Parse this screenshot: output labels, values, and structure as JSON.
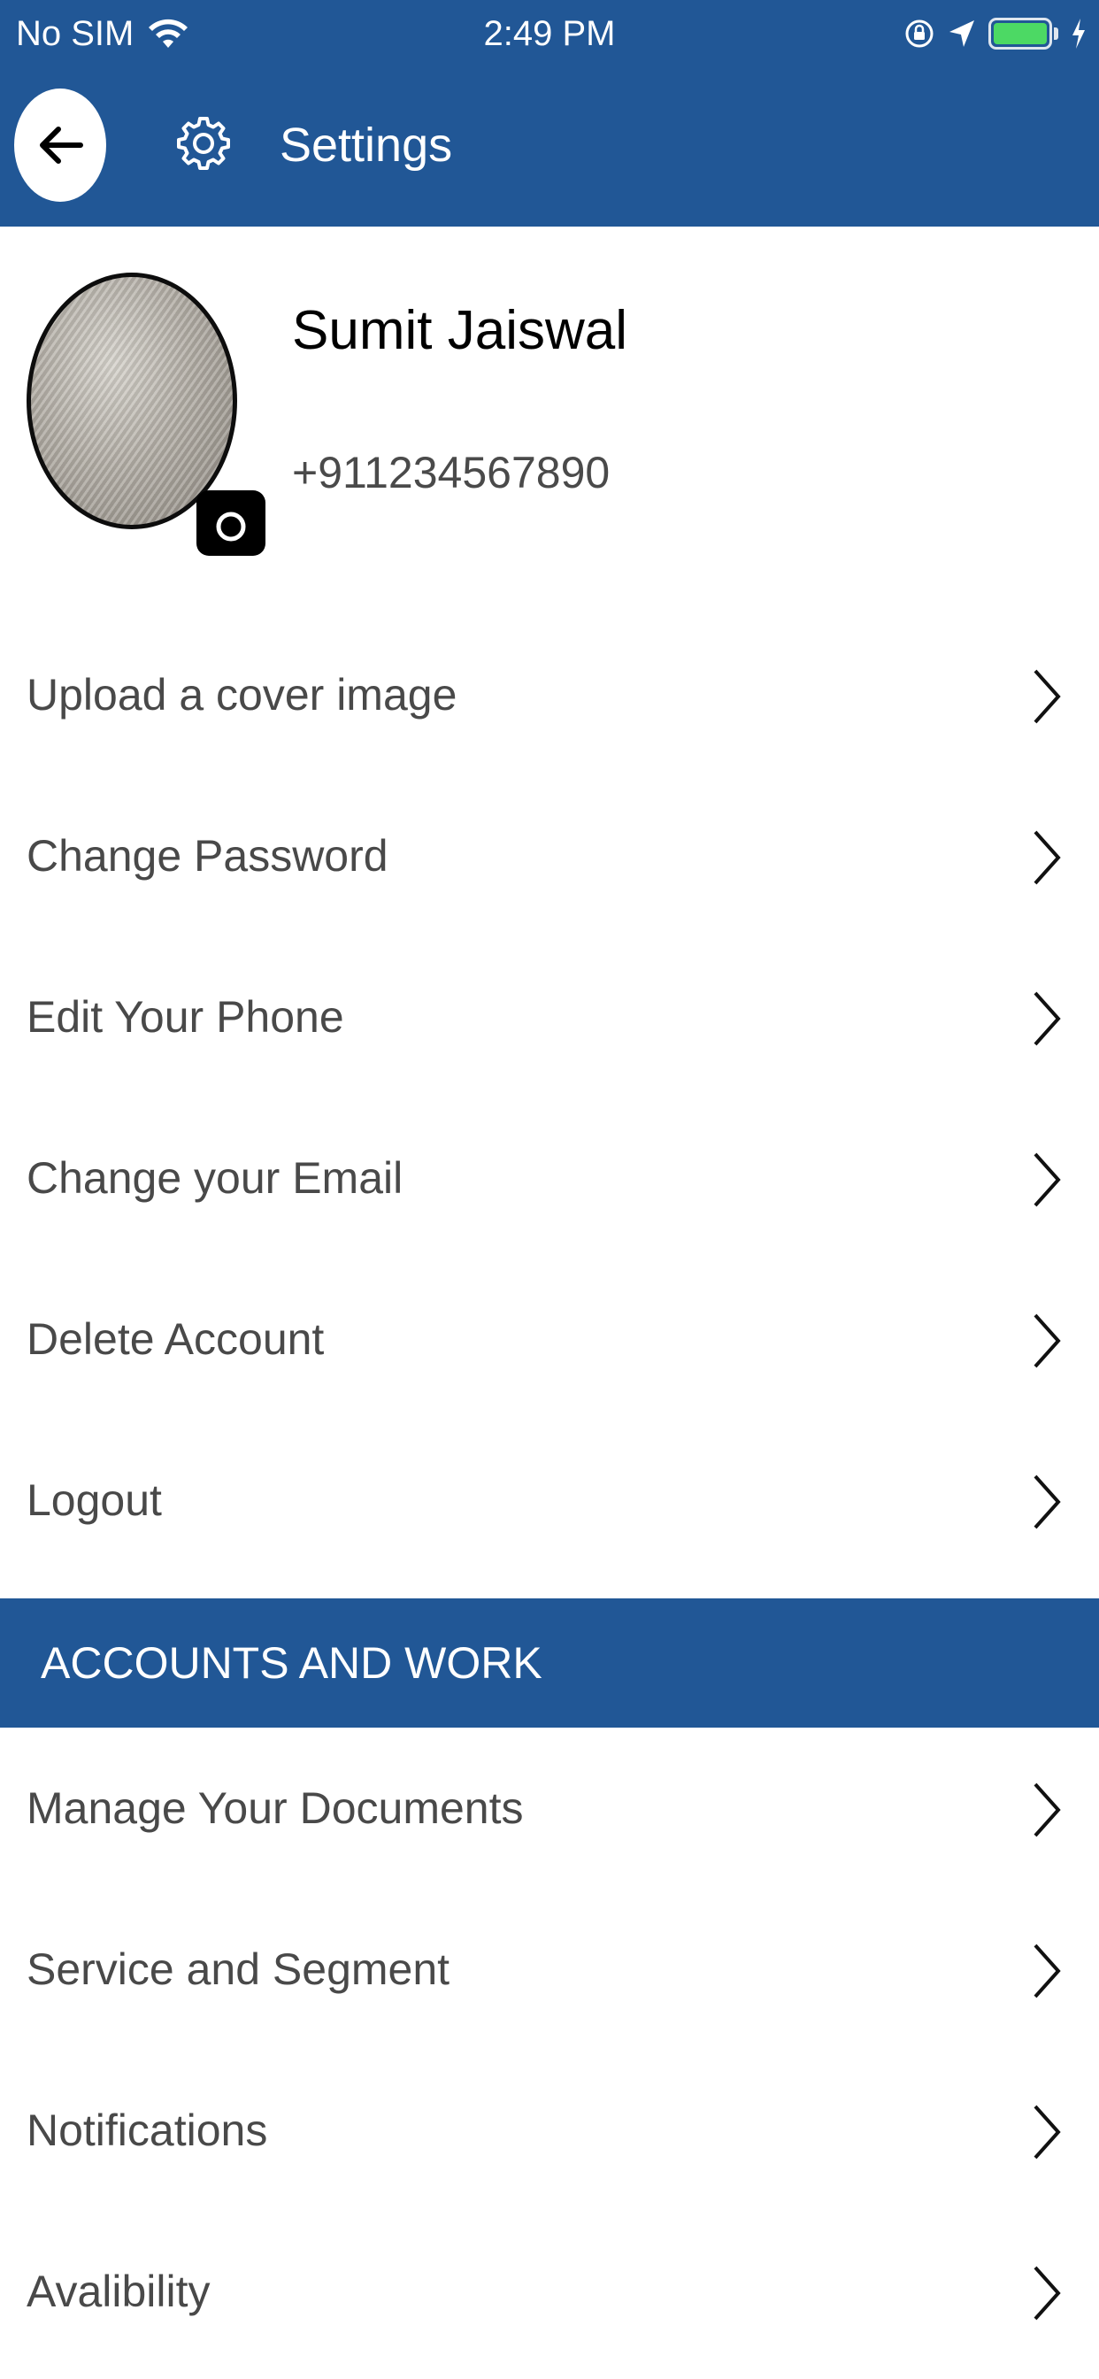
{
  "status_bar": {
    "carrier": "No SIM",
    "time": "2:49 PM",
    "battery_level": 1.0,
    "battery_color": "#4cd964"
  },
  "nav": {
    "title": "Settings",
    "back_icon": "arrow-left-icon",
    "title_icon": "gear-icon",
    "background": "#215796"
  },
  "profile": {
    "name": "Sumit Jaiswal",
    "phone": "+911234567890",
    "camera_icon": "camera-icon"
  },
  "menu": {
    "items": [
      {
        "label": "Upload a cover image"
      },
      {
        "label": "Change Password"
      },
      {
        "label": "Edit Your Phone"
      },
      {
        "label": "Change your Email"
      },
      {
        "label": "Delete Account"
      },
      {
        "label": "Logout"
      }
    ]
  },
  "accounts_section": {
    "title": "ACCOUNTS AND WORK",
    "items": [
      {
        "label": "Manage Your Documents"
      },
      {
        "label": "Service and Segment"
      },
      {
        "label": "Notifications"
      },
      {
        "label": "Avalibility"
      }
    ]
  }
}
